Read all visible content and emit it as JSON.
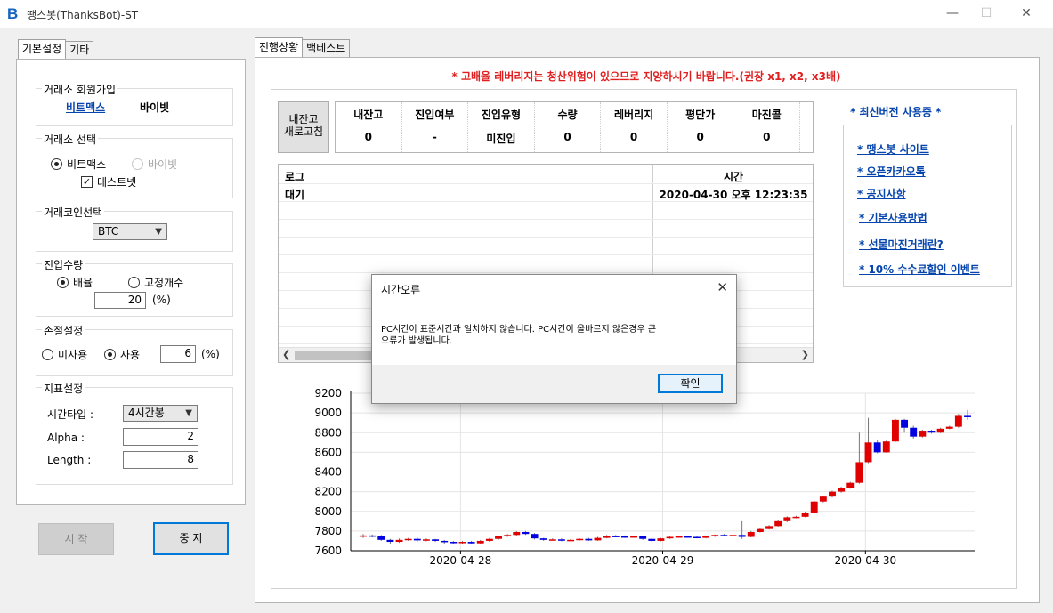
{
  "window": {
    "icon_glyph": "B",
    "title": "땡스봇(ThanksBot)-ST",
    "minimize": "—",
    "maximize": "☐",
    "close": "✕"
  },
  "left_tabs": [
    "기본설정",
    "기타"
  ],
  "exchange_signup": {
    "title": "거래소 회원가입",
    "links": [
      "비트맥스",
      "바이빗"
    ]
  },
  "exchange_select": {
    "title": "거래소 선택",
    "options": [
      "비트맥스",
      "바이빗"
    ],
    "selected": "비트맥스",
    "testnet_label": "테스트넷",
    "testnet_checked": true
  },
  "coin_select": {
    "title": "거래코인선택",
    "value": "BTC"
  },
  "entry_qty": {
    "title": "진입수량",
    "options": [
      "배율",
      "고정개수"
    ],
    "selected": "배율",
    "value": "20",
    "unit": "(%)"
  },
  "stop_loss": {
    "title": "손절설정",
    "options": [
      "미사용",
      "사용"
    ],
    "selected": "사용",
    "value": "6",
    "unit": "(%)"
  },
  "indicator": {
    "title": "지표설정",
    "timeframe_label": "시간타입 :",
    "timeframe_value": "4시간봉",
    "alpha_label": "Alpha :",
    "alpha_value": "2",
    "length_label": "Length :",
    "length_value": "8"
  },
  "controls": {
    "start": "시 작",
    "stop": "중 지"
  },
  "right_tabs": [
    "진행상황",
    "백테스트"
  ],
  "warning": "* 고배율 레버리지는 청산위험이 있으므로 지양하시기 바랍니다.(권장 x1, x2, x3배)",
  "refresh_button": [
    "내잔고",
    "새로고침"
  ],
  "stats": {
    "headers": [
      "내잔고",
      "진입여부",
      "진입유형",
      "수량",
      "레버리지",
      "평단가",
      "마진콜"
    ],
    "values": [
      "0",
      "-",
      "미진입",
      "0",
      "0",
      "0",
      "0"
    ]
  },
  "log": {
    "headers": [
      "로그",
      "시간"
    ],
    "rows": [
      [
        "대기",
        "2020-04-30 오후 12:23:35"
      ]
    ]
  },
  "side": {
    "status": "* 최신버전 사용중 *",
    "links": [
      "* 땡스봇 사이트",
      "* 오픈카카오톡",
      "* 공지사항",
      "* 기본사용방법",
      "* 선물마진거래란?",
      "* 10% 수수료할인 이벤트"
    ]
  },
  "dialog": {
    "title": "시간오류",
    "message_line1": "PC시간이 표준시간과 일치하지 않습니다. PC시간이 올바르지 않은경우 큰",
    "message_line2": "오류가 발생됩니다.",
    "ok": "확인",
    "close": "✕"
  },
  "chart_data": {
    "type": "candlestick",
    "x_tick_labels": [
      "2020-04-28",
      "2020-04-29",
      "2020-04-30"
    ],
    "y_tick_labels": [
      "9200",
      "9000",
      "8800",
      "8600",
      "8400",
      "8200",
      "8000",
      "7800",
      "7600"
    ],
    "ylim": [
      7600,
      9200
    ],
    "grid": true,
    "up_color": "#e00000",
    "down_color": "#0000e0",
    "candles": [
      [
        7750,
        7755,
        7730,
        7770
      ],
      [
        7755,
        7745,
        7735,
        7765
      ],
      [
        7745,
        7710,
        7700,
        7760
      ],
      [
        7710,
        7690,
        7670,
        7720
      ],
      [
        7690,
        7710,
        7680,
        7725
      ],
      [
        7710,
        7720,
        7700,
        7730
      ],
      [
        7720,
        7705,
        7690,
        7735
      ],
      [
        7705,
        7715,
        7695,
        7725
      ],
      [
        7715,
        7700,
        7690,
        7720
      ],
      [
        7700,
        7690,
        7670,
        7710
      ],
      [
        7690,
        7680,
        7670,
        7700
      ],
      [
        7680,
        7690,
        7670,
        7700
      ],
      [
        7690,
        7675,
        7665,
        7700
      ],
      [
        7675,
        7700,
        7670,
        7710
      ],
      [
        7700,
        7720,
        7690,
        7730
      ],
      [
        7720,
        7745,
        7710,
        7750
      ],
      [
        7745,
        7760,
        7740,
        7770
      ],
      [
        7760,
        7790,
        7750,
        7800
      ],
      [
        7790,
        7770,
        7760,
        7800
      ],
      [
        7770,
        7725,
        7715,
        7780
      ],
      [
        7725,
        7710,
        7700,
        7730
      ],
      [
        7710,
        7715,
        7705,
        7725
      ],
      [
        7715,
        7705,
        7695,
        7725
      ],
      [
        7705,
        7710,
        7700,
        7720
      ],
      [
        7710,
        7720,
        7705,
        7725
      ],
      [
        7720,
        7705,
        7700,
        7730
      ],
      [
        7705,
        7730,
        7700,
        7740
      ],
      [
        7730,
        7750,
        7725,
        7760
      ],
      [
        7750,
        7745,
        7740,
        7760
      ],
      [
        7745,
        7740,
        7730,
        7755
      ],
      [
        7740,
        7745,
        7735,
        7750
      ],
      [
        7745,
        7720,
        7710,
        7750
      ],
      [
        7720,
        7700,
        7690,
        7725
      ],
      [
        7700,
        7725,
        7695,
        7730
      ],
      [
        7725,
        7740,
        7720,
        7745
      ],
      [
        7740,
        7745,
        7735,
        7750
      ],
      [
        7745,
        7740,
        7730,
        7750
      ],
      [
        7740,
        7730,
        7725,
        7745
      ],
      [
        7730,
        7745,
        7725,
        7750
      ],
      [
        7745,
        7760,
        7740,
        7765
      ],
      [
        7760,
        7750,
        7745,
        7770
      ],
      [
        7750,
        7760,
        7745,
        7780
      ],
      [
        7760,
        7740,
        7720,
        7900
      ],
      [
        7740,
        7790,
        7735,
        7800
      ],
      [
        7790,
        7820,
        7785,
        7830
      ],
      [
        7820,
        7850,
        7815,
        7860
      ],
      [
        7850,
        7900,
        7845,
        7910
      ],
      [
        7900,
        7940,
        7890,
        7950
      ],
      [
        7940,
        7945,
        7930,
        7955
      ],
      [
        7945,
        7980,
        7940,
        7990
      ],
      [
        7980,
        8100,
        7975,
        8110
      ],
      [
        8100,
        8150,
        8090,
        8160
      ],
      [
        8150,
        8200,
        8140,
        8210
      ],
      [
        8200,
        8240,
        8190,
        8250
      ],
      [
        8240,
        8290,
        8230,
        8300
      ],
      [
        8290,
        8500,
        8280,
        8800
      ],
      [
        8500,
        8700,
        8490,
        8950
      ],
      [
        8700,
        8600,
        8590,
        8720
      ],
      [
        8600,
        8710,
        8595,
        8720
      ],
      [
        8710,
        8930,
        8705,
        8940
      ],
      [
        8930,
        8850,
        8800,
        8940
      ],
      [
        8850,
        8760,
        8740,
        8870
      ],
      [
        8760,
        8820,
        8750,
        8830
      ],
      [
        8820,
        8800,
        8790,
        8830
      ],
      [
        8800,
        8840,
        8795,
        8850
      ],
      [
        8840,
        8860,
        8835,
        8870
      ],
      [
        8860,
        8970,
        8850,
        8990
      ],
      [
        8970,
        8960,
        8930,
        9030
      ]
    ]
  }
}
